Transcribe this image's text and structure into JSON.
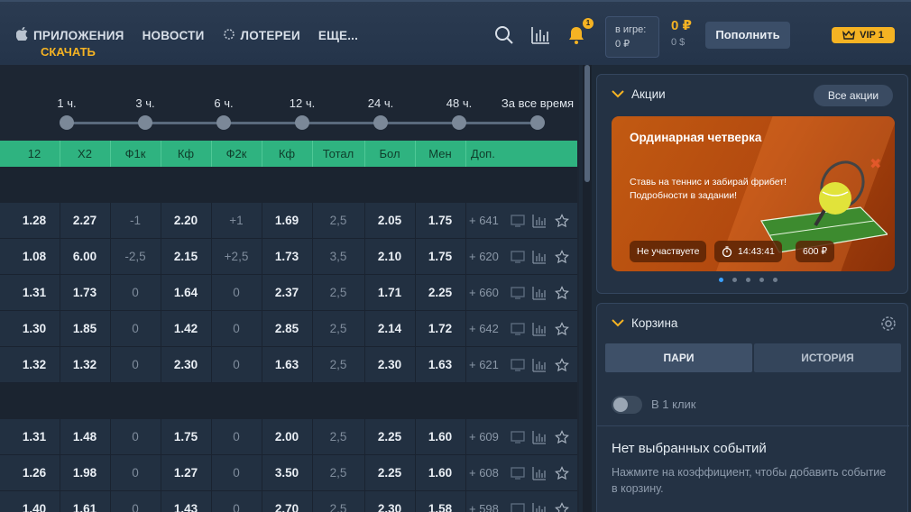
{
  "header": {
    "nav": [
      {
        "label": "ПРИЛОЖЕНИЯ",
        "icon": "apple-icon"
      },
      {
        "label": "НОВОСТИ",
        "icon": ""
      },
      {
        "label": "ЛОТЕРЕИ",
        "icon": "lottery-icon"
      },
      {
        "label": "ЕЩЕ...",
        "icon": ""
      }
    ],
    "download": "СКАЧАТЬ",
    "notifications_badge": "1",
    "in_game_label": "в игре:",
    "in_game_value": "0 ₽",
    "balance_main": "0 ₽",
    "balance_sub": "0 $",
    "topup": "Пополнить",
    "vip": "VIP 1"
  },
  "timeline": {
    "labels": [
      "1 ч.",
      "3 ч.",
      "6 ч.",
      "12 ч.",
      "24 ч.",
      "48 ч.",
      "За все время"
    ]
  },
  "table": {
    "columns": [
      "12",
      "X2",
      "Ф1к",
      "Кф",
      "Ф2к",
      "Кф",
      "Тотал",
      "Бол",
      "Мен",
      "Доп."
    ],
    "group1": [
      [
        "1.28",
        "2.27",
        "-1",
        "2.20",
        "+1",
        "1.69",
        "2,5",
        "2.05",
        "1.75",
        "+ 641"
      ],
      [
        "1.08",
        "6.00",
        "-2,5",
        "2.15",
        "+2,5",
        "1.73",
        "3,5",
        "2.10",
        "1.75",
        "+ 620"
      ],
      [
        "1.31",
        "1.73",
        "0",
        "1.64",
        "0",
        "2.37",
        "2,5",
        "1.71",
        "2.25",
        "+ 660"
      ],
      [
        "1.30",
        "1.85",
        "0",
        "1.42",
        "0",
        "2.85",
        "2,5",
        "2.14",
        "1.72",
        "+ 642"
      ],
      [
        "1.32",
        "1.32",
        "0",
        "2.30",
        "0",
        "1.63",
        "2,5",
        "2.30",
        "1.63",
        "+ 621"
      ]
    ],
    "group2": [
      [
        "1.31",
        "1.48",
        "0",
        "1.75",
        "0",
        "2.00",
        "2,5",
        "2.25",
        "1.60",
        "+ 609"
      ],
      [
        "1.26",
        "1.98",
        "0",
        "1.27",
        "0",
        "3.50",
        "2,5",
        "2.25",
        "1.60",
        "+ 608"
      ],
      [
        "1.40",
        "1.61",
        "0",
        "1.43",
        "0",
        "2.70",
        "2,5",
        "2.30",
        "1.58",
        "+ 598"
      ]
    ]
  },
  "promos": {
    "title": "Акции",
    "all_button": "Все акции",
    "banner": {
      "title": "Ординарная четверка",
      "text": "Ставь на теннис и забирай фрибет! Подробности в задании!",
      "status": "Не участвуете",
      "timer": "14:43:41",
      "prize": "600 ₽"
    }
  },
  "betslip": {
    "title": "Корзина",
    "tabs": [
      "ПАРИ",
      "ИСТОРИЯ"
    ],
    "one_click": "В 1 клик",
    "empty_title": "Нет выбранных событий",
    "empty_text": "Нажмите на коэффициент, чтобы добавить событие в корзину."
  },
  "colors": {
    "accent": "#f5b323",
    "table_header": "#2fb380",
    "background": "#1e2a38"
  }
}
